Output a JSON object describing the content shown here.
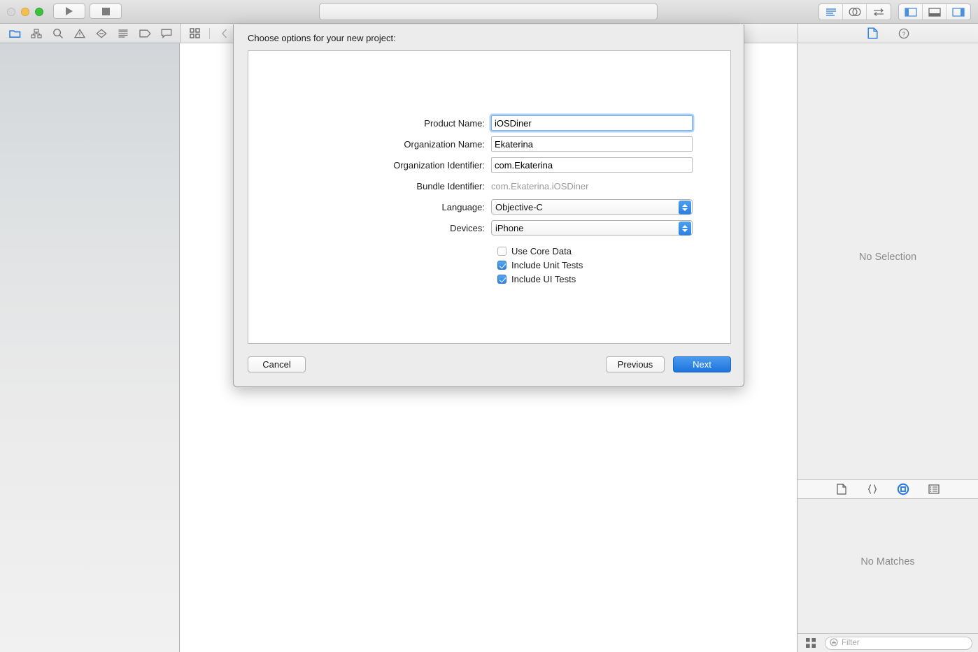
{
  "titlebar": {
    "traffic": [
      "close",
      "minimize",
      "maximize"
    ],
    "run_icon": "play-icon",
    "stop_icon": "stop-icon",
    "status_placeholder": "",
    "right_icons": [
      "standard-editor-icon",
      "assistant-editor-icon",
      "version-editor-icon",
      "navigator-toggle-icon",
      "debug-area-toggle-icon",
      "utilities-toggle-icon"
    ]
  },
  "navigator_bar": {
    "icons": [
      "project-navigator-icon",
      "symbol-navigator-icon",
      "find-navigator-icon",
      "issue-navigator-icon",
      "test-navigator-icon",
      "debug-navigator-icon",
      "breakpoint-navigator-icon",
      "report-navigator-icon"
    ]
  },
  "jumpbar": {
    "related_items_icon": "related-items-icon",
    "back_icon": "chevron-left-icon",
    "forward_icon": "chevron-right-icon"
  },
  "inspector_topbar": {
    "icons": [
      "file-inspector-icon",
      "quick-help-icon"
    ]
  },
  "inspector": {
    "no_selection": "No Selection",
    "no_matches": "No Matches",
    "library_tabs": [
      "file-template-library-icon",
      "code-snippet-library-icon",
      "object-library-icon",
      "media-library-icon"
    ],
    "selected_library_tab": 2,
    "view_mode_icon": "grid-view-icon",
    "filter_placeholder": "Filter",
    "filter_value": "",
    "filter_icon": "filter-lens-icon"
  },
  "sheet": {
    "title": "Choose options for your new project:",
    "fields": [
      {
        "label": "Product Name:",
        "value": "iOSDiner",
        "type": "text",
        "focused": true,
        "name": "product-name"
      },
      {
        "label": "Organization Name:",
        "value": "Ekaterina",
        "type": "text",
        "focused": false,
        "name": "organization-name"
      },
      {
        "label": "Organization Identifier:",
        "value": "com.Ekaterina",
        "type": "text",
        "focused": false,
        "name": "organization-identifier"
      },
      {
        "label": "Bundle Identifier:",
        "value": "com.Ekaterina.iOSDiner",
        "type": "static",
        "focused": false,
        "name": "bundle-identifier"
      },
      {
        "label": "Language:",
        "value": "Objective-C",
        "type": "popup",
        "focused": false,
        "name": "language"
      },
      {
        "label": "Devices:",
        "value": "iPhone",
        "type": "popup",
        "focused": false,
        "name": "devices"
      }
    ],
    "checkboxes": [
      {
        "label": "Use Core Data",
        "checked": false,
        "name": "use-core-data"
      },
      {
        "label": "Include Unit Tests",
        "checked": true,
        "name": "include-unit-tests"
      },
      {
        "label": "Include UI Tests",
        "checked": true,
        "name": "include-ui-tests"
      }
    ],
    "buttons": {
      "cancel": "Cancel",
      "previous": "Previous",
      "next": "Next"
    },
    "accent_color": "#2f82e4"
  }
}
